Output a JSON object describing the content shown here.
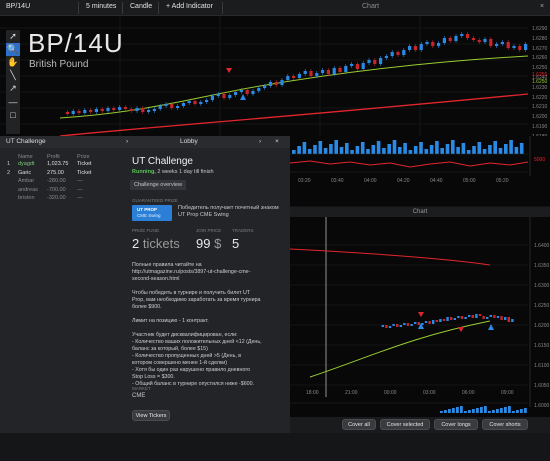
{
  "topbar": {
    "symbol": "BP/14U",
    "timeframe": "5 minutes",
    "chart_type": "Candle",
    "add_indicator": "+ Add Indicator",
    "chart_title": "Chart",
    "close": "×"
  },
  "main_chart": {
    "symbol_big": "BP/14U",
    "symbol_name": "British Pound",
    "price_ticks": [
      "1.6290",
      "1.6280",
      "1.6270",
      "1.6260",
      "1.6250",
      "1.6240",
      "1.6230",
      "1.6220",
      "1.6210",
      "1.6200",
      "1.6190",
      "1.6180"
    ],
    "highlight_price_red": "1.6255",
    "highlight_price_green": "1.6250",
    "time_ticks": [
      "03:20",
      "03:40",
      "04:00",
      "04:20",
      "04:40",
      "05:00",
      "05:20"
    ],
    "volume_label": "5000"
  },
  "ut_panel": {
    "title": "UT Challenge",
    "headers": [
      "Name",
      "Profit",
      "Prize"
    ],
    "rows": [
      {
        "rank": "1",
        "name": "dyagdt",
        "profit": "1,023.75",
        "prize": "Ticket"
      },
      {
        "rank": "2",
        "name": "Garic",
        "profit": "275.00",
        "prize": "Ticket"
      },
      {
        "rank": "",
        "name": "Ambar",
        "profit": "-280.00",
        "prize": "—"
      },
      {
        "rank": "",
        "name": "andreas",
        "profit": "-700.00",
        "prize": "—"
      },
      {
        "rank": "",
        "name": "briston",
        "profit": "-320.00",
        "prize": "—"
      }
    ]
  },
  "lobby": {
    "title": "Lobby",
    "challenge_title": "UT Challenge",
    "status_running": "Running,",
    "status_rest": "2 weeks 1 day till finish",
    "tab_overview": "Challenge overview",
    "guaranteed_prize_label": "GUARANTEED PRIZE",
    "prize_badge_line1": "UT PROP",
    "prize_badge_line2": "CME Swing",
    "prize_desc": "Победитель получает почетный знаком UT Prop CME Swing",
    "prize_fund_label": "PRIZE FUND",
    "join_price_label": "JOIN PRICE",
    "traders_label": "TRADERS",
    "prize_fund_value": "2",
    "prize_fund_unit": "tickets",
    "join_price_value": "99",
    "join_price_unit": "$",
    "traders_value": "5",
    "rules_text": "Полные правила читайте на\nhttp://utmagazine.ru/posts/3897-ut-challenge-cme-\nsecond-season.html\n\nЧтобы победить в турнире и получить билет UT\nProp, вам необходимо заработать за время турнира\nболее $900.\n\nЛимит на позицию - 1 контракт.\n\nУчастник будет дисквалифицирован, если:\n- Количество ваших положительных дней <12 (День,\nбаланс за который, более $15)\n- Количество пропущенных дней >5 (День, в\nкотором совершено менее 1-й сделки)\n- Хотя бы один раз нарушено правило дневного\nStop Loss = $300.\n- Общий баланс в турнире опустился ниже -$600.",
    "market_label": "MARKET",
    "market_value": "CME",
    "view_tickers": "View Tickers"
  },
  "chart2": {
    "title": "Chart",
    "price_ticks": [
      "1.6400",
      "1.6350",
      "1.6300",
      "1.6250",
      "1.6200",
      "1.6150",
      "1.6100",
      "1.6050",
      "1.6000"
    ],
    "time_ticks": [
      "18:00",
      "21:00",
      "00:00",
      "03:00",
      "06:00",
      "09:00"
    ]
  },
  "bottom_buttons": {
    "cover_all": "Cover all",
    "cover_selected": "Cover selected",
    "cover_longs": "Cover longs",
    "cover_shorts": "Cover shorts"
  },
  "colors": {
    "bull": "#2a8be6",
    "bear": "#c8262c",
    "ma_green": "#9acd32",
    "ma_red": "#e3262c",
    "accent": "#3a78d6"
  }
}
